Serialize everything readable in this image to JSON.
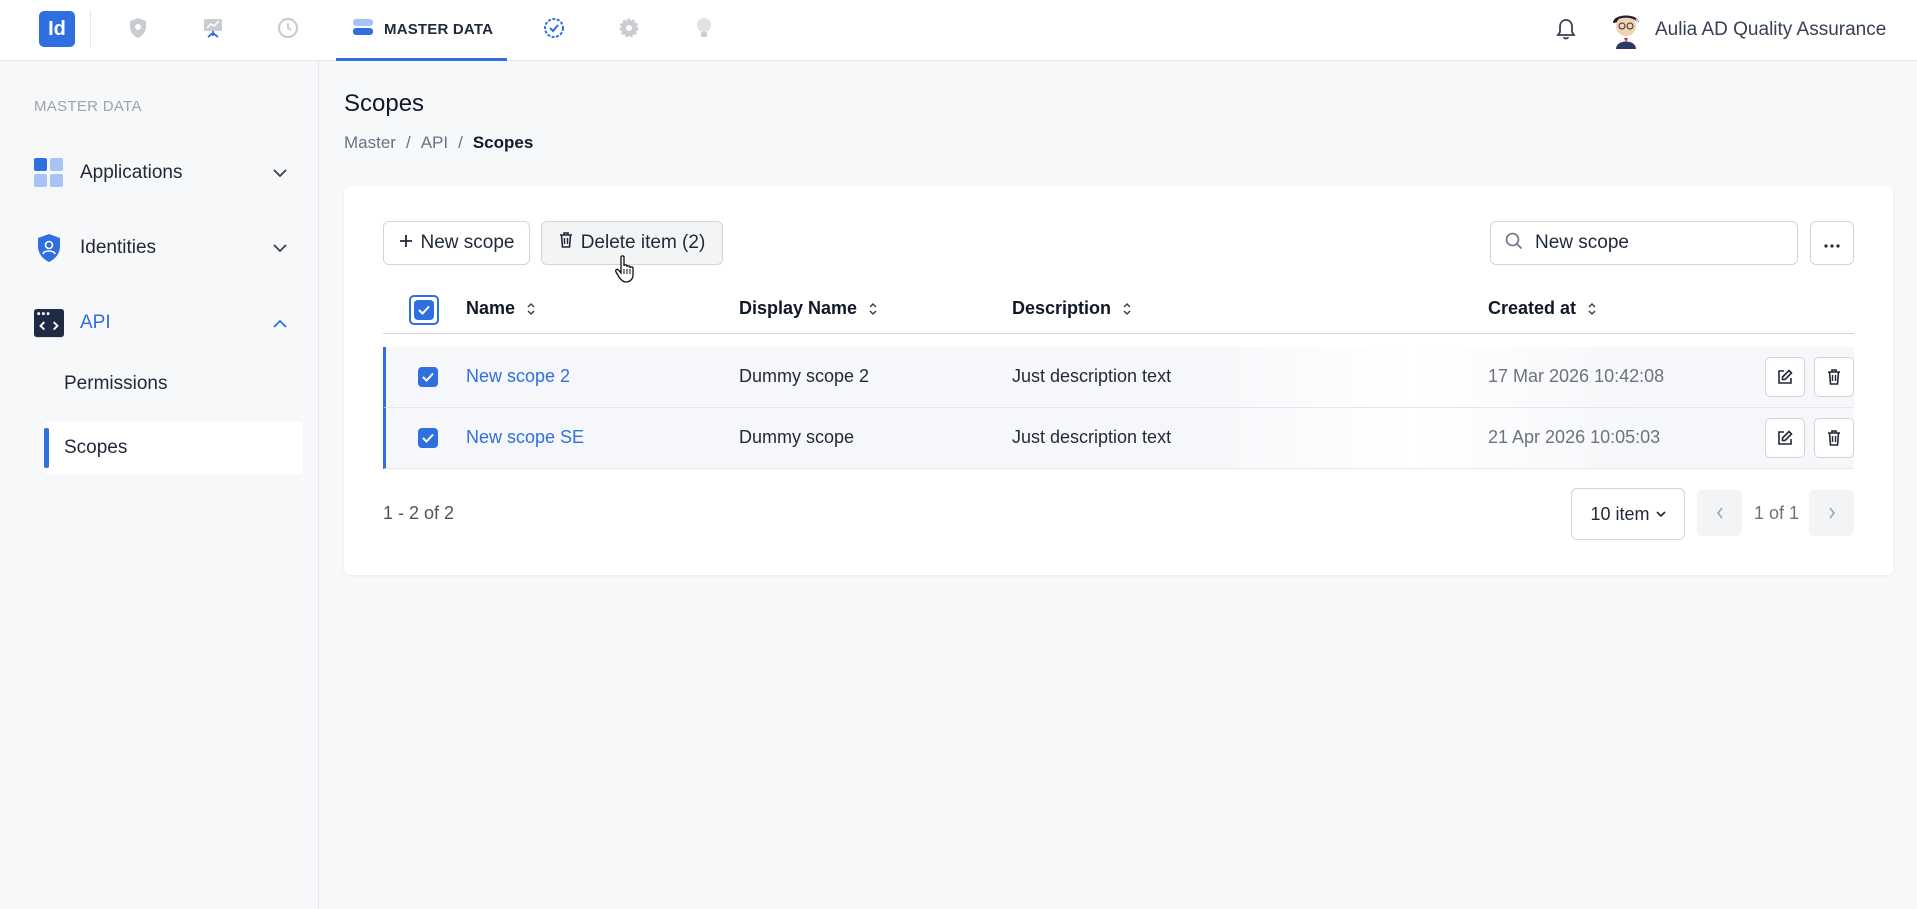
{
  "app": {
    "logo_text": "Id",
    "accent_color": "#2f6fe0"
  },
  "topnav": {
    "icons": [
      "shield-icon",
      "presentation-chart-icon",
      "history-icon",
      "database-icon",
      "badge-check-icon",
      "gear-icon",
      "lightbulb-icon"
    ],
    "active_tab": "MASTER DATA",
    "user_name": "Aulia AD Quality Assurance"
  },
  "sidebar": {
    "section": "MASTER DATA",
    "items": [
      {
        "label": "Applications",
        "icon": "applications-grid-icon",
        "expanded": false
      },
      {
        "label": "Identities",
        "icon": "identity-shield-icon",
        "expanded": false
      },
      {
        "label": "API",
        "icon": "code-window-icon",
        "expanded": true
      }
    ],
    "sub_items": [
      "Permissions",
      "Scopes"
    ],
    "selected_sub": "Scopes"
  },
  "page": {
    "title": "Scopes",
    "breadcrumb": [
      "Master",
      "API",
      "Scopes"
    ],
    "breadcrumb_sep": "/"
  },
  "toolbar": {
    "new_label": "New scope",
    "delete_label": "Delete item (2)",
    "search_value": "New scope",
    "more_label": "···"
  },
  "table": {
    "columns": [
      "Name",
      "Display Name",
      "Description",
      "Created at"
    ],
    "rows": [
      {
        "name": "New scope 2",
        "display_name": "Dummy scope 2",
        "description": "Just description text",
        "created_at": "17 Mar 2026 10:42:08",
        "checked": true
      },
      {
        "name": "New scope SE",
        "display_name": "Dummy scope",
        "description": "Just description text",
        "created_at": "21 Apr 2026 10:05:03",
        "checked": true
      }
    ]
  },
  "pagination": {
    "range_text": "1 - 2 of 2",
    "page_size": "10 item",
    "page_text": "1 of 1"
  }
}
